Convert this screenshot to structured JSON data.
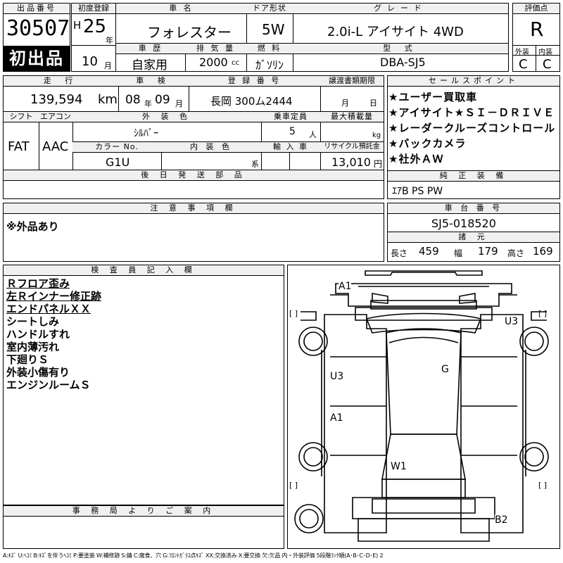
{
  "header": {
    "lot_no_label": "出品番号",
    "lot_no": "30507",
    "first_listing_badge": "初出品",
    "first_reg_label": "初度登録",
    "era_mark": "H",
    "reg_year": "25",
    "year_unit": "年",
    "reg_month": "10",
    "month_unit": "月",
    "car_name_label": "車 名",
    "car_name": "フォレスター",
    "door_label": "ドア形状",
    "door": "5W",
    "grade_label": "グレード",
    "grade": "2.0i-L アイサイト 4WD",
    "score_label": "評価点",
    "score": "R",
    "history_label": "車 歴",
    "history": "自家用",
    "displacement_label": "排 気 量",
    "displacement": "2000",
    "displacement_unit": "cc",
    "fuel_label": "燃 料",
    "fuel": "ｶﾞｿﾘﾝ",
    "model_code_label": "型 式",
    "model_code": "DBA-SJ5",
    "exterior_label": "外装",
    "exterior_grade": "C",
    "interior_label": "内装",
    "interior_grade": "C"
  },
  "row2": {
    "mileage_label": "走 行",
    "mileage": "139,594",
    "mileage_unit": "km",
    "inspection_label": "車 検",
    "insp_year": "08",
    "insp_year_unit": "年",
    "insp_month": "09",
    "insp_month_unit": "月",
    "plate_label": "登 録 番 号",
    "plate": "長岡 300ム2444",
    "transfer_label": "譲渡書類期限",
    "transfer_month_unit": "月",
    "transfer_day_unit": "日",
    "shift_label": "シフト",
    "shift": "FAT",
    "aircon_label": "エアコン",
    "aircon": "AAC",
    "ext_color_label": "外 装 色",
    "ext_color": "ｼﾙﾊﾞｰ",
    "capacity_label": "乗車定員",
    "capacity": "5",
    "capacity_unit": "人",
    "load_label": "最大積載量",
    "load_unit": "kg",
    "color_no_label": "カラー No.",
    "color_no": "G1U",
    "int_color_label": "内 装 色",
    "int_color_unit": "系",
    "import_label": "輸 入 車",
    "recycle_label": "リサイクル預託金",
    "recycle": "13,010",
    "recycle_unit": "円",
    "later_parts_label": "後 日 発 送 部 品"
  },
  "sales_points": {
    "label": "セールスポイント",
    "items": [
      "★ユーザー買取車",
      "★アイサイト★ＳＩ－ＤＲＩＶＥ",
      "★レーダークルーズコントロール",
      "★バックカメラ",
      "★社外ＡＷ"
    ]
  },
  "equipment": {
    "label": "純 正 装 備",
    "value": "ｴｱB PS PW"
  },
  "notes": {
    "label": "注 意 事 項 欄",
    "text": "※外品あり"
  },
  "chassis": {
    "label": "車 台 番 号",
    "value": "SJ5-018520",
    "dims_label": "諸 元",
    "length_label": "長さ",
    "length": "459",
    "width_label": "幅",
    "width": "179",
    "height_label": "高さ",
    "height": "169"
  },
  "inspector": {
    "label": "検 査 員 記 入 欄",
    "lines": [
      {
        "text": "Ｒフロア歪み",
        "underline": true
      },
      {
        "text": "左Ｒインナー修正跡",
        "underline": true
      },
      {
        "text": "エンドパネルＸＸ",
        "underline": true
      },
      {
        "text": "シートしみ",
        "underline": false
      },
      {
        "text": "ハンドルすれ",
        "underline": false
      },
      {
        "text": "室内薄汚れ",
        "underline": false
      },
      {
        "text": "下廻りＳ",
        "underline": false
      },
      {
        "text": "外装小傷有り",
        "underline": false
      },
      {
        "text": "エンジンルームＳ",
        "underline": false
      }
    ]
  },
  "office": {
    "label": "事 務 局 よ り ご 案 内"
  },
  "diagram_marks": {
    "a1_top": "A1",
    "u3_right": "U3",
    "u3_left": "U3",
    "g_center": "G",
    "a1_left": "A1",
    "w1_rear": "W1",
    "b2_rear": "B2",
    "bracket": "[ ]"
  },
  "legend": "A:ｷｽﾞ U:ﾍｺﾐ B:ｷｽﾞを伴うﾍｺﾐ P:要塗装 W:補修跡 S:錆 C:腐食、穴 G:ﾌﾛﾝﾄｶﾞﾗｽ点ｷｽﾞ XX:交換済み X:要交換 欠:欠品 内・外装評価 5段階ﾗﾝｸ順(A･B･C･D･E) 2"
}
